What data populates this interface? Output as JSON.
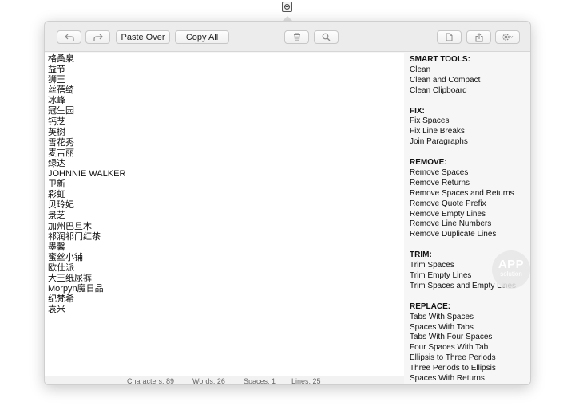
{
  "toolbar": {
    "undo_icon": "undo-arrow-icon",
    "redo_icon": "redo-arrow-icon",
    "paste_over_label": "Paste Over",
    "copy_all_label": "Copy All",
    "trash_icon": "trash-icon",
    "search_icon": "magnifier-icon",
    "new_doc_icon": "document-icon",
    "share_icon": "share-icon",
    "settings_icon": "gear-icon"
  },
  "editor": {
    "lines": [
      "格桑泉",
      "益节",
      "狮王",
      "丝蓓绮",
      "冰峰",
      "冠生园",
      "钙芝",
      "英树",
      "雪花秀",
      "麦吉丽",
      "绿达",
      "JOHNNIE WALKER",
      "卫新",
      "彩虹",
      "贝玲妃",
      "景芝",
      "加州巴旦木",
      "祁润祁门红茶",
      "墨馨",
      "蜜丝小铺",
      "欧仕派",
      "大王纸尿裤",
      "Morpyn魔日品",
      "纪梵希",
      "袁米"
    ]
  },
  "status": {
    "characters": "Characters: 89",
    "words": "Words: 26",
    "spaces": "Spaces: 1",
    "lines": "Lines: 25"
  },
  "sidebar": {
    "smart_tools": {
      "title": "SMART TOOLS:",
      "items": [
        "Clean",
        "Clean and Compact",
        "Clean Clipboard"
      ]
    },
    "fix": {
      "title": "FIX:",
      "items": [
        "Fix Spaces",
        "Fix Line Breaks",
        "Join Paragraphs"
      ]
    },
    "remove": {
      "title": "REMOVE:",
      "items": [
        "Remove Spaces",
        "Remove Returns",
        "Remove Spaces and Returns",
        "Remove Quote Prefix",
        "Remove Empty Lines",
        "Remove Line Numbers",
        "Remove Duplicate Lines"
      ]
    },
    "trim": {
      "title": "TRIM:",
      "items": [
        "Trim Spaces",
        "Trim Empty Lines",
        "Trim Spaces and Empty Lines"
      ]
    },
    "replace": {
      "title": "REPLACE:",
      "items": [
        "Tabs With Spaces",
        "Spaces With Tabs",
        "Tabs With Four Spaces",
        "Four Spaces With Tab",
        "Ellipsis to Three Periods",
        "Three Periods to Ellipsis",
        "Spaces With Returns"
      ]
    }
  },
  "watermark": {
    "big": "APP",
    "small": "solution"
  },
  "colors": {
    "window_bg": "#f6f6f6",
    "editor_bg": "#ffffff",
    "toolbar_bg": "#ececec"
  }
}
